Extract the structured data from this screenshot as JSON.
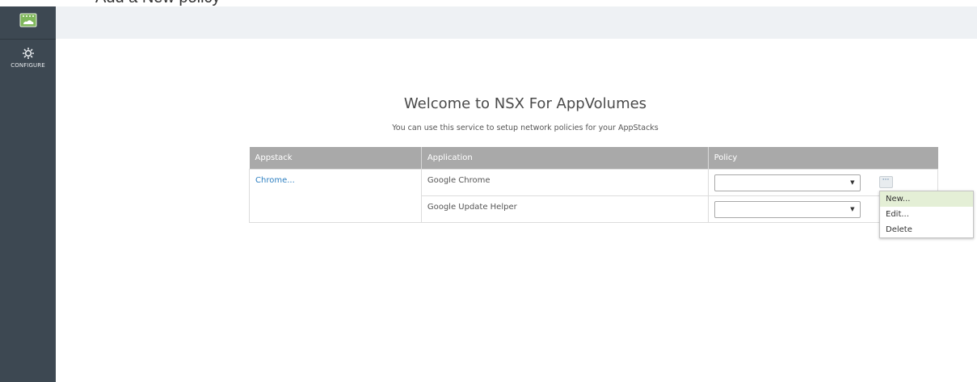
{
  "top_strip_text": "Add a New policy",
  "sidebar": {
    "nav_configure_label": "CONFIGURE"
  },
  "main": {
    "title": "Welcome to NSX For AppVolumes",
    "subtitle": "You can use this service to setup network policies for your AppStacks"
  },
  "table": {
    "headers": [
      "Appstack",
      "Application",
      "Policy"
    ],
    "appstack_name": "Chrome...",
    "rows": [
      {
        "application": "Google Chrome",
        "policy_value": ""
      },
      {
        "application": "Google Update Helper",
        "policy_value": ""
      }
    ],
    "more_label": "···"
  },
  "context_menu": {
    "items": [
      "New...",
      "Edit...",
      "Delete"
    ]
  },
  "colors": {
    "sidebar_bg": "#3d4852",
    "header_band_bg": "#eef1f4",
    "table_header_bg": "#a9a9a9",
    "link": "#2d7fc1",
    "menu_active_bg": "#e4efd6"
  }
}
